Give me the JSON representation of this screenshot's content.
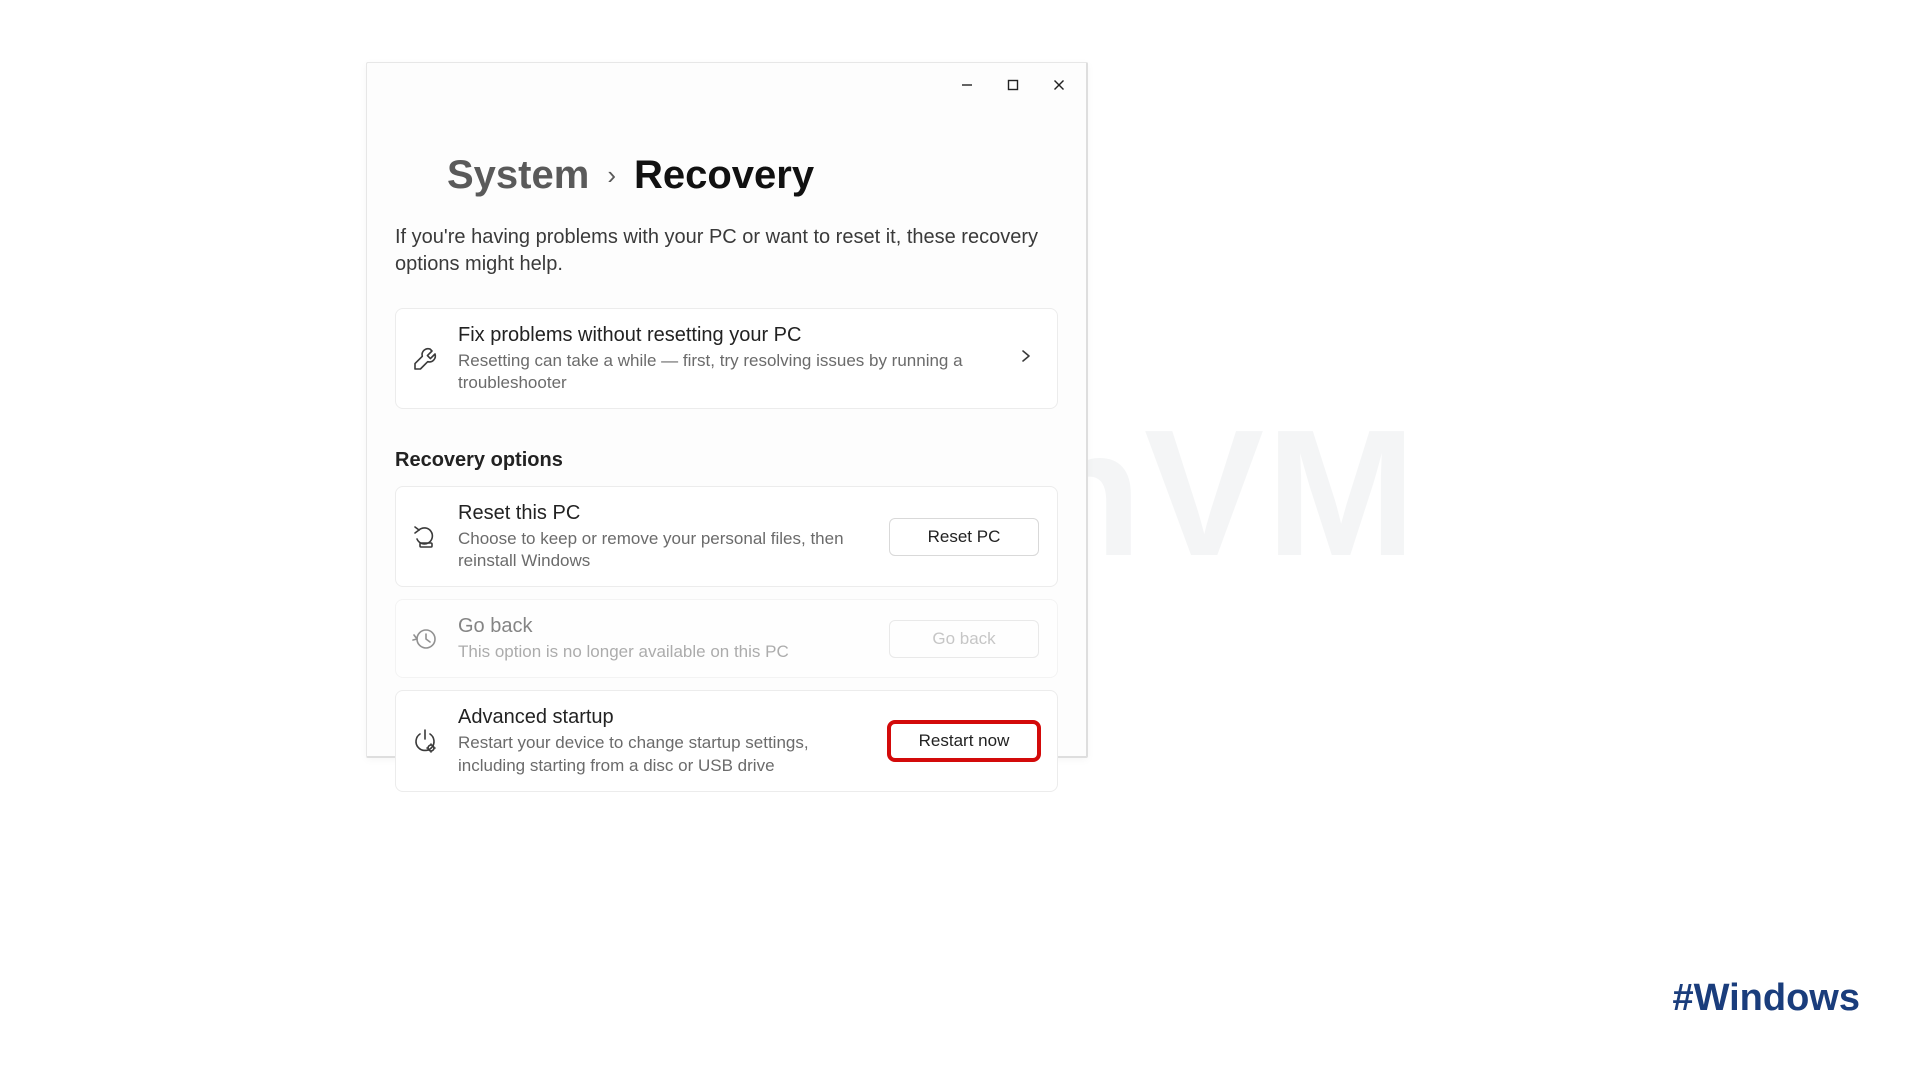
{
  "watermark": "NeuronVM",
  "hashtag": "#Windows",
  "breadcrumb": {
    "parent": "System",
    "separator": "›",
    "current": "Recovery"
  },
  "intro": "If you're having problems with your PC or want to reset it, these recovery options might help.",
  "fix": {
    "title": "Fix problems without resetting your PC",
    "desc": "Resetting can take a while — first, try resolving issues by running a troubleshooter"
  },
  "section_label": "Recovery options",
  "reset": {
    "title": "Reset this PC",
    "desc": "Choose to keep or remove your personal files, then reinstall Windows",
    "button": "Reset PC"
  },
  "goback": {
    "title": "Go back",
    "desc": "This option is no longer available on this PC",
    "button": "Go back"
  },
  "advanced": {
    "title": "Advanced startup",
    "desc": "Restart your device to change startup settings, including starting from a disc or USB drive",
    "button": "Restart now"
  }
}
